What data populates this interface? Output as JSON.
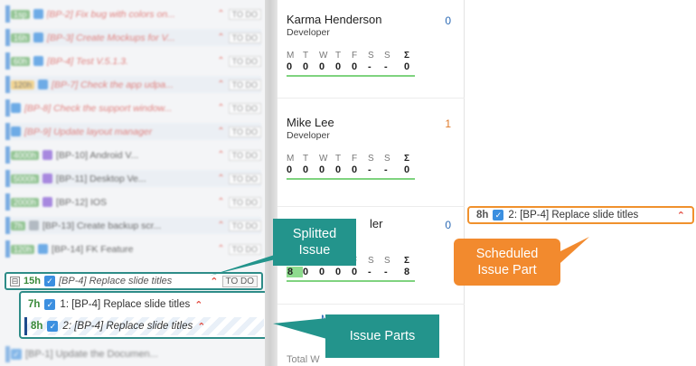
{
  "backlog": {
    "rows": [
      {
        "est": "1sp",
        "title": "[BP-2] Fix bug with colors on...",
        "status": "TO DO",
        "top": 0
      },
      {
        "est": "16h",
        "title": "[BP-3] Create Mockups for V...",
        "status": "TO DO",
        "top": 0
      },
      {
        "est": "60h",
        "title": "[BP-4] Test V.5.1.3.",
        "status": "TO DO",
        "top": 0
      },
      {
        "est": "120h",
        "title": "[BP-7] Check the app udpa...",
        "status": "TO DO",
        "top": 0
      },
      {
        "est": "",
        "title": "[BP-8] Check the support window...",
        "status": "TO DO",
        "top": 0
      },
      {
        "est": "",
        "title": "[BP-9] Update layout manager",
        "status": "TO DO",
        "top": 0
      },
      {
        "est": "4000h",
        "title": "[BP-10] Android V...",
        "status": "TO DO",
        "top": 0
      },
      {
        "est": "5000h",
        "title": "[BP-11] Desktop Ve...",
        "status": "TO DO",
        "top": 0
      },
      {
        "est": "2000h",
        "title": "[BP-12] IOS",
        "status": "TO DO",
        "top": 0
      },
      {
        "est": "7h",
        "title": "[BP-13] Create backup scr...",
        "status": "TO DO",
        "top": 0
      },
      {
        "est": "120h",
        "title": "[BP-14] FK Feature",
        "status": "TO DO",
        "top": 0
      }
    ],
    "split_issue": {
      "expander": "⊟",
      "est": "15h",
      "title": "[BP-4] Replace slide titles",
      "status": "TO DO"
    },
    "parts": [
      {
        "est": "7h",
        "title": "1: [BP-4] Replace slide titles"
      },
      {
        "est": "8h",
        "title": "2: [BP-4] Replace slide titles"
      }
    ],
    "bottom_row": {
      "title": "[BP-1] Update the Documen..."
    }
  },
  "people": [
    {
      "name": "Karma Henderson",
      "role": "Developer",
      "count": "0",
      "count_color": "#2d6bb5",
      "days": [
        "0",
        "0",
        "0",
        "0",
        "0",
        "-",
        "-"
      ],
      "sum": "0"
    },
    {
      "name": "Mike Lee",
      "role": "Developer",
      "count": "1",
      "count_color": "#e07a2a",
      "days": [
        "0",
        "0",
        "0",
        "0",
        "0",
        "-",
        "-"
      ],
      "sum": "0"
    },
    {
      "name": "ler",
      "role": "",
      "count": "0",
      "count_color": "#2d6bb5",
      "days": [
        "8",
        "0",
        "0",
        "0",
        "0",
        "-",
        "-"
      ],
      "sum": "8"
    }
  ],
  "day_labels": [
    "M",
    "T",
    "W",
    "T",
    "F",
    "S",
    "S"
  ],
  "sum_label": "Σ",
  "more_link": "M",
  "total_label": "Total W",
  "schedule": {
    "card": {
      "est": "8h",
      "title": "2: [BP-4] Replace slide titles"
    }
  },
  "callouts": {
    "splitted": "Splitted Issue",
    "scheduled": "Scheduled Issue Part",
    "parts": "Issue Parts"
  },
  "colors": {
    "teal": "#23948c",
    "orange": "#f28a2e",
    "accent": "#3b8fe0"
  }
}
